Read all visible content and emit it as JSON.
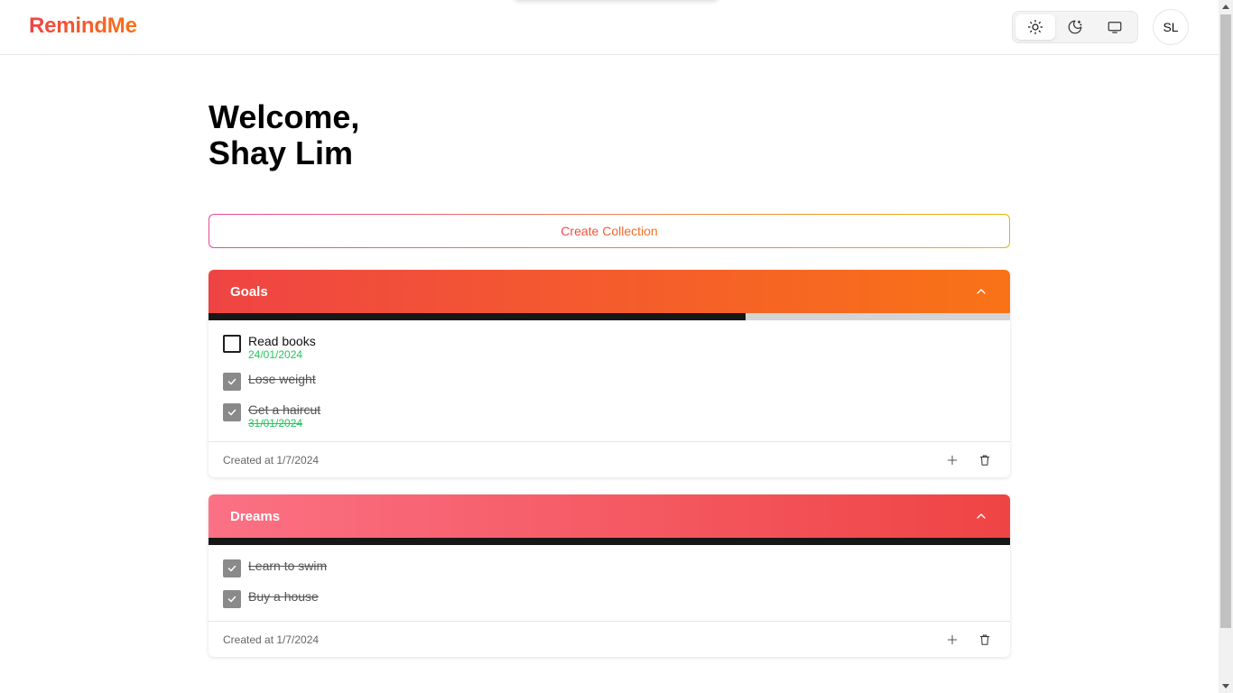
{
  "app": {
    "name": "RemindMe"
  },
  "header": {
    "theme_options": [
      "light",
      "dark",
      "system"
    ],
    "active_theme": "light",
    "avatar_initials": "SL"
  },
  "welcome": {
    "line1": "Welcome,",
    "line2": "Shay Lim"
  },
  "create_button": {
    "label": "Create Collection"
  },
  "collections": [
    {
      "name": "Goals",
      "gradient": [
        "#ef4444",
        "#f97316"
      ],
      "progress_percent": 67,
      "tasks": [
        {
          "title": "Read books",
          "date": "24/01/2024",
          "done": false
        },
        {
          "title": "Lose weight",
          "date": "",
          "done": true
        },
        {
          "title": "Get a haircut",
          "date": "31/01/2024",
          "done": true
        }
      ],
      "created_label": "Created at 1/7/2024"
    },
    {
      "name": "Dreams",
      "gradient": [
        "#fb7185",
        "#ef4444"
      ],
      "progress_percent": 100,
      "tasks": [
        {
          "title": "Learn to swim",
          "date": "",
          "done": true
        },
        {
          "title": "Buy a house",
          "date": "",
          "done": true
        }
      ],
      "created_label": "Created at 1/7/2024"
    }
  ],
  "colors": {
    "accent_start": "#ef4444",
    "accent_end": "#f97316",
    "date_green": "#22c55e",
    "progress_fill": "#171717"
  }
}
